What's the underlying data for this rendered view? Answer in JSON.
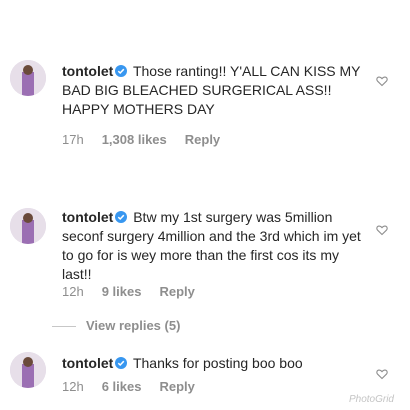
{
  "comments": [
    {
      "username": "tontolet",
      "text": "Those ranting!! Y'ALL CAN KISS MY BAD BIG BLEACHED SURGERICAL ASS!! HAPPY MOTHERS DAY",
      "time": "17h",
      "likes": "1,308 likes",
      "reply": "Reply"
    },
    {
      "username": "tontolet",
      "text": "Btw my 1st surgery was 5million seconf surgery 4million and the 3rd which im yet to go for is wey more than the first cos its my last!!",
      "time": "12h",
      "likes": "9 likes",
      "reply": "Reply"
    },
    {
      "username": "tontolet",
      "text": "Thanks for posting boo boo",
      "time": "12h",
      "likes": "6 likes",
      "reply": "Reply"
    }
  ],
  "view_replies": "View replies (5)",
  "watermark": "PhotoGrid",
  "colors": {
    "text": "#262626",
    "meta": "#8e8e8e",
    "verified": "#3897f0"
  },
  "icons": {
    "verified": "verified-badge-icon",
    "like": "heart-outline-icon"
  }
}
